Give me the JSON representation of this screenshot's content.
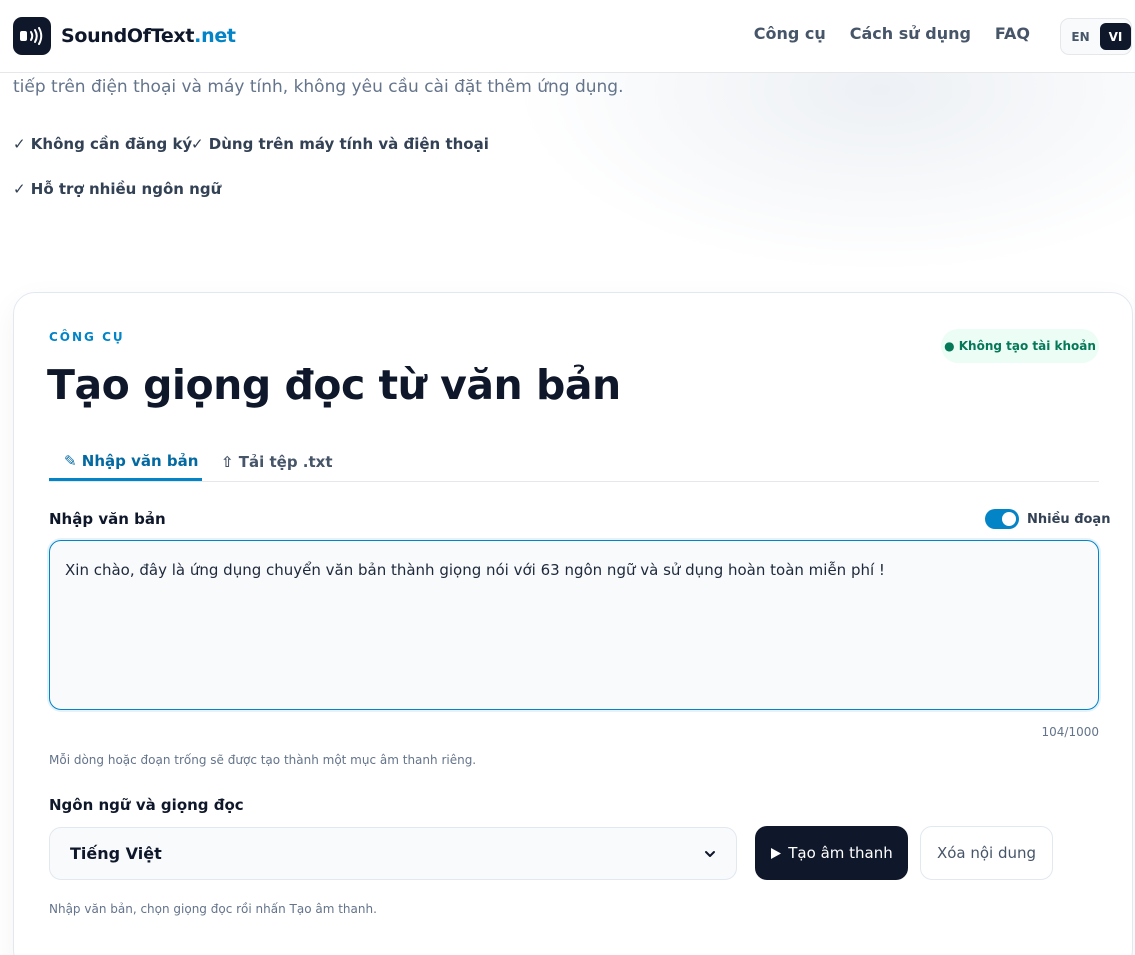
{
  "header": {
    "logo_name": "SoundOfText",
    "logo_tld": ".net",
    "logo_icon": "sound-wave-icon",
    "nav": [
      "Công cụ",
      "Cách sử dụng",
      "FAQ"
    ],
    "languages": [
      "EN",
      "VI"
    ],
    "active_language": "VI"
  },
  "intro": {
    "text": "tiếp trên điện thoại và máy tính, không yêu cầu cài đặt thêm ứng dụng.",
    "features": [
      "✓ Không cần đăng ký",
      "✓ Dùng trên máy tính và điện thoại",
      "✓ Hỗ trợ nhiều ngôn ngữ"
    ]
  },
  "tool": {
    "eyebrow": "CÔNG CỤ",
    "badge": "● Không tạo tài khoản",
    "title": "Tạo giọng đọc từ văn bản",
    "tabs": [
      {
        "label": "✎ Nhập văn bản",
        "active": true
      },
      {
        "label": "⇧ Tải tệp .txt",
        "active": false
      }
    ],
    "input_label": "Nhập văn bản",
    "multi_paragraph_label": "Nhiều đoạn",
    "multi_paragraph_on": true,
    "text_value": "Xin chào, đây là ứng dụng chuyển văn bản thành giọng nói với 63 ngôn ngữ và sử dụng hoàn toàn miễn phí !",
    "char_count": "104/1000",
    "paragraph_hint": "Mỗi dòng hoặc đoạn trống sẽ được tạo thành một mục âm thanh riêng.",
    "voice_label": "Ngôn ngữ và giọng đọc",
    "selected_voice": "Tiếng Việt",
    "generate_label": "Tạo âm thanh",
    "clear_label": "Xóa nội dung",
    "status_hint": "Nhập văn bản, chọn giọng đọc rồi nhấn Tạo âm thanh."
  },
  "colors": {
    "accent": "#0284c7",
    "dark": "#0f172a",
    "badge_bg": "#ecfdf5",
    "badge_text": "#047857"
  }
}
